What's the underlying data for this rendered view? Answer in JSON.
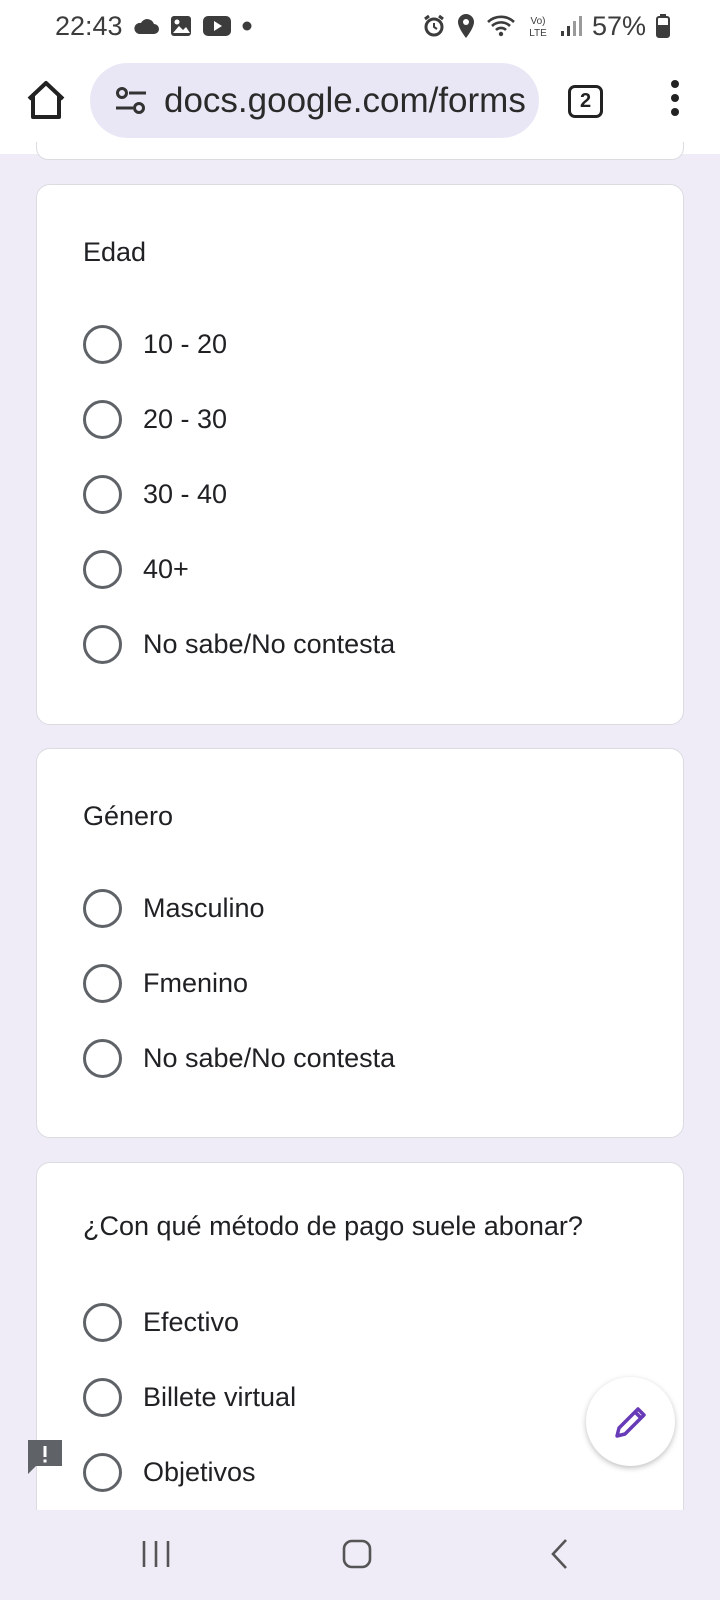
{
  "status_bar": {
    "time": "22:43",
    "battery": "57%",
    "left_icons": [
      "cloud-icon",
      "image-icon",
      "youtube-icon",
      "dot-icon"
    ],
    "right_icons": [
      "alarm-icon",
      "location-icon",
      "wifi-icon",
      "volte-icon",
      "signal-icon",
      "battery-icon"
    ],
    "volte_label": "Vo) LTE"
  },
  "browser": {
    "url": "docs.google.com/forms",
    "tab_count": "2"
  },
  "form": {
    "questions": [
      {
        "title": "Edad",
        "options": [
          "10 - 20",
          "20 - 30",
          "30 - 40",
          "40+",
          "No sabe/No contesta"
        ]
      },
      {
        "title": "Género",
        "options": [
          "Masculino",
          "Fmenino",
          "No sabe/No contesta"
        ]
      },
      {
        "title": "¿Con qué método de pago suele abonar?",
        "options": [
          "Efectivo",
          "Billete virtual",
          "Objetivos"
        ]
      }
    ]
  },
  "colors": {
    "page_background": "#efebf7",
    "fab_accent": "#673ab7",
    "radio_border": "#5f6368"
  },
  "buttons": {
    "fab_icon": "pencil-icon",
    "feedback_icon": "feedback-icon"
  },
  "nav_bar": {
    "items": [
      "recents-icon",
      "home-icon",
      "back-icon"
    ]
  }
}
